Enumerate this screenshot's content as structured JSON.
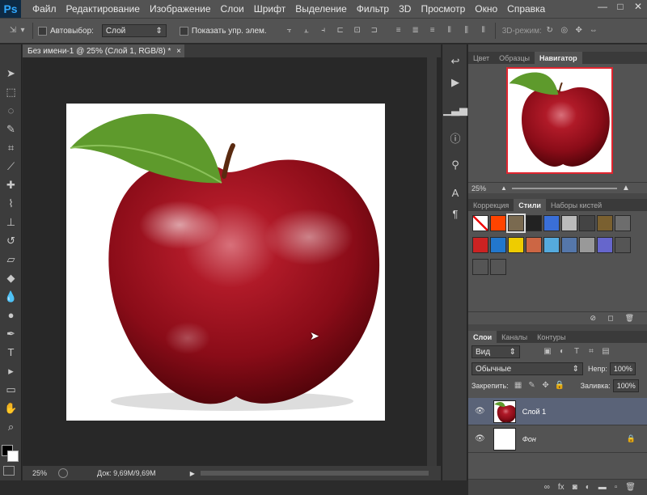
{
  "app": {
    "logo": "Ps"
  },
  "menu": {
    "items": [
      "Файл",
      "Редактирование",
      "Изображение",
      "Слои",
      "Шрифт",
      "Выделение",
      "Фильтр",
      "3D",
      "Просмотр",
      "Окно",
      "Справка"
    ]
  },
  "window_controls": {
    "minimize": "—",
    "maximize": "□",
    "close": "✕"
  },
  "options": {
    "autoselect_label": "Автовыбор:",
    "autoselect_value": "Слой",
    "show_transform_label": "Показать упр. элем.",
    "mode3d_label": "3D-режим:"
  },
  "document": {
    "tab_title": "Без имени-1 @ 25% (Слой 1, RGB/8) *",
    "tab_close": "×"
  },
  "status": {
    "zoom": "25%",
    "doc_info": "Док: 9,69M/9,69M",
    "arrow": "▶"
  },
  "navigator": {
    "tabs": [
      "Цвет",
      "Образцы",
      "Навигатор"
    ],
    "active_tab": "Навигатор",
    "zoom": "25%"
  },
  "styles": {
    "tabs": [
      "Коррекция",
      "Стили",
      "Наборы кистей"
    ],
    "active_tab": "Стили",
    "swatches": [
      "#ffffff",
      "#ff4400",
      "#7a6a50",
      "#222222",
      "#3a6fd8",
      "#bbbbbb",
      "#444444",
      "#7a6030",
      "#6d6d6d",
      "#cc2222",
      "#2277cc",
      "#eecc00",
      "#cc6644",
      "#55aadd",
      "#5577aa",
      "#999999",
      "#6666cc",
      "#555555",
      "#555555",
      "#555555"
    ]
  },
  "layers": {
    "tabs": [
      "Слои",
      "Каналы",
      "Контуры"
    ],
    "active_tab": "Слои",
    "filter_label": "Вид",
    "blend_mode": "Обычные",
    "opacity_label": "Непр:",
    "opacity_value": "100%",
    "lock_label": "Закрепить:",
    "fill_label": "Заливка:",
    "fill_value": "100%",
    "items": [
      {
        "name": "Слой 1",
        "selected": true
      },
      {
        "name": "Фон",
        "selected": false
      }
    ],
    "footer_icons": [
      "link-icon",
      "fx-icon",
      "mask-icon",
      "adjustment-icon",
      "group-icon",
      "new-layer-icon",
      "trash-icon"
    ]
  },
  "colors": {
    "accent": "#31a8ff",
    "selected_layer": "#5a6378",
    "nav_frame": "#e0252f"
  }
}
